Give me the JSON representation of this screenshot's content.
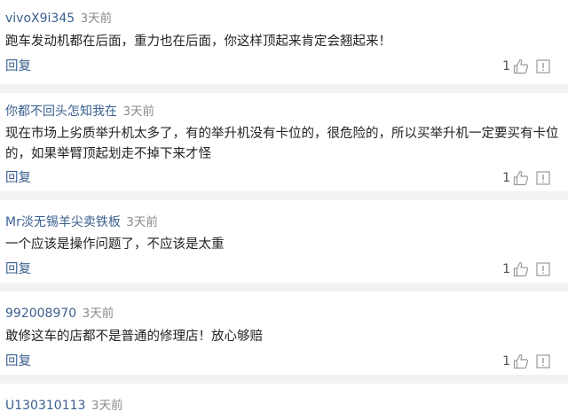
{
  "comments": [
    {
      "user": "vivoX9i345",
      "time": "3天前",
      "lines": [
        "跑车发动机都在后面，重力也在后面，你这样顶起来肯定会翘起来！"
      ],
      "reply_label": "回复",
      "likes": "1"
    },
    {
      "user": "你都不回头怎知我在",
      "time": "3天前",
      "lines": [
        "现在市场上劣质举升机太多了，有的举升机没有卡位的，很危险的，所以买举升机一定要买有卡位",
        "的，如果举臂顶起划走不掉下来才怪"
      ],
      "reply_label": "回复",
      "likes": "1"
    },
    {
      "user": "Mr淡无锡羊尖卖铁板",
      "time": "3天前",
      "lines": [
        "一个应该是操作问题了，不应该是太重"
      ],
      "reply_label": "回复",
      "likes": "1"
    },
    {
      "user": "992008970",
      "time": "3天前",
      "lines": [
        "敢修这车的店都不是普通的修理店！放心够赔"
      ],
      "reply_label": "回复",
      "likes": "1"
    },
    {
      "user": "U130310113",
      "time": "3天前",
      "lines": [],
      "reply_label": "",
      "likes": ""
    }
  ]
}
